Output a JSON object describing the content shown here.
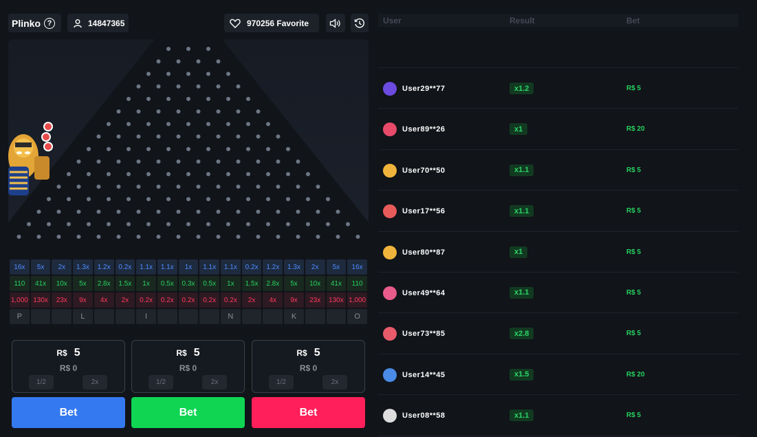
{
  "header": {
    "game_title": "Plinko",
    "help_icon": "question-circle-icon",
    "user_id": "14847365",
    "favorite_count": "970256 Favorite",
    "icons": [
      "user-icon",
      "heart-icon",
      "speaker-icon",
      "history-icon"
    ]
  },
  "multipliers": {
    "row_blue": [
      "16x",
      "5x",
      "2x",
      "1.3x",
      "1.2x",
      "0.2x",
      "1.1x",
      "1.1x",
      "1x",
      "1.1x",
      "1.1x",
      "0.2x",
      "1.2x",
      "1.3x",
      "2x",
      "5x",
      "16x"
    ],
    "row_green": [
      "110",
      "41x",
      "10x",
      "5x",
      "2.8x",
      "1.5x",
      "1x",
      "0.5x",
      "0.3x",
      "0.5x",
      "1x",
      "1.5x",
      "2.8x",
      "5x",
      "10x",
      "41x",
      "110"
    ],
    "row_red": [
      "1,000",
      "130x",
      "23x",
      "9x",
      "4x",
      "2x",
      "0.2x",
      "0.2x",
      "0.2x",
      "0.2x",
      "0.2x",
      "2x",
      "4x",
      "9x",
      "23x",
      "130x",
      "1,000"
    ],
    "row_letters": [
      "P",
      "",
      "",
      "L",
      "",
      "",
      "I",
      "",
      "",
      "",
      "N",
      "",
      "",
      "K",
      "",
      "",
      "O"
    ]
  },
  "bet_panels": [
    {
      "currency": "R$",
      "amount": "5",
      "win": "R$ 0",
      "half": "1/2",
      "double": "2x",
      "button": "Bet",
      "color": "#3479f0"
    },
    {
      "currency": "R$",
      "amount": "5",
      "win": "R$ 0",
      "half": "1/2",
      "double": "2x",
      "button": "Bet",
      "color": "#0fd553"
    },
    {
      "currency": "R$",
      "amount": "5",
      "win": "R$ 0",
      "half": "1/2",
      "double": "2x",
      "button": "Bet",
      "color": "#ff1f5a"
    }
  ],
  "history": {
    "columns": {
      "user": "User",
      "result": "Result",
      "bet": "Bet"
    },
    "rows": [
      {
        "user": "User29**77",
        "result": "x1.2",
        "bet": "R$ 5"
      },
      {
        "user": "User89**26",
        "result": "x1",
        "bet": "R$ 20"
      },
      {
        "user": "User70**50",
        "result": "x1.1",
        "bet": "R$ 5"
      },
      {
        "user": "User17**56",
        "result": "x1.1",
        "bet": "R$ 5"
      },
      {
        "user": "User80**87",
        "result": "x1",
        "bet": "R$ 5"
      },
      {
        "user": "User49**64",
        "result": "x1.1",
        "bet": "R$ 5"
      },
      {
        "user": "User73**85",
        "result": "x2.8",
        "bet": "R$ 5"
      },
      {
        "user": "User14**45",
        "result": "x1.5",
        "bet": "R$ 20"
      },
      {
        "user": "User08**58",
        "result": "x1.1",
        "bet": "R$ 5"
      }
    ]
  },
  "colors": {
    "background": "#111419",
    "blue": "#3479f0",
    "green": "#0fd553",
    "red": "#ff1f5a",
    "peg": "#6d7685"
  }
}
